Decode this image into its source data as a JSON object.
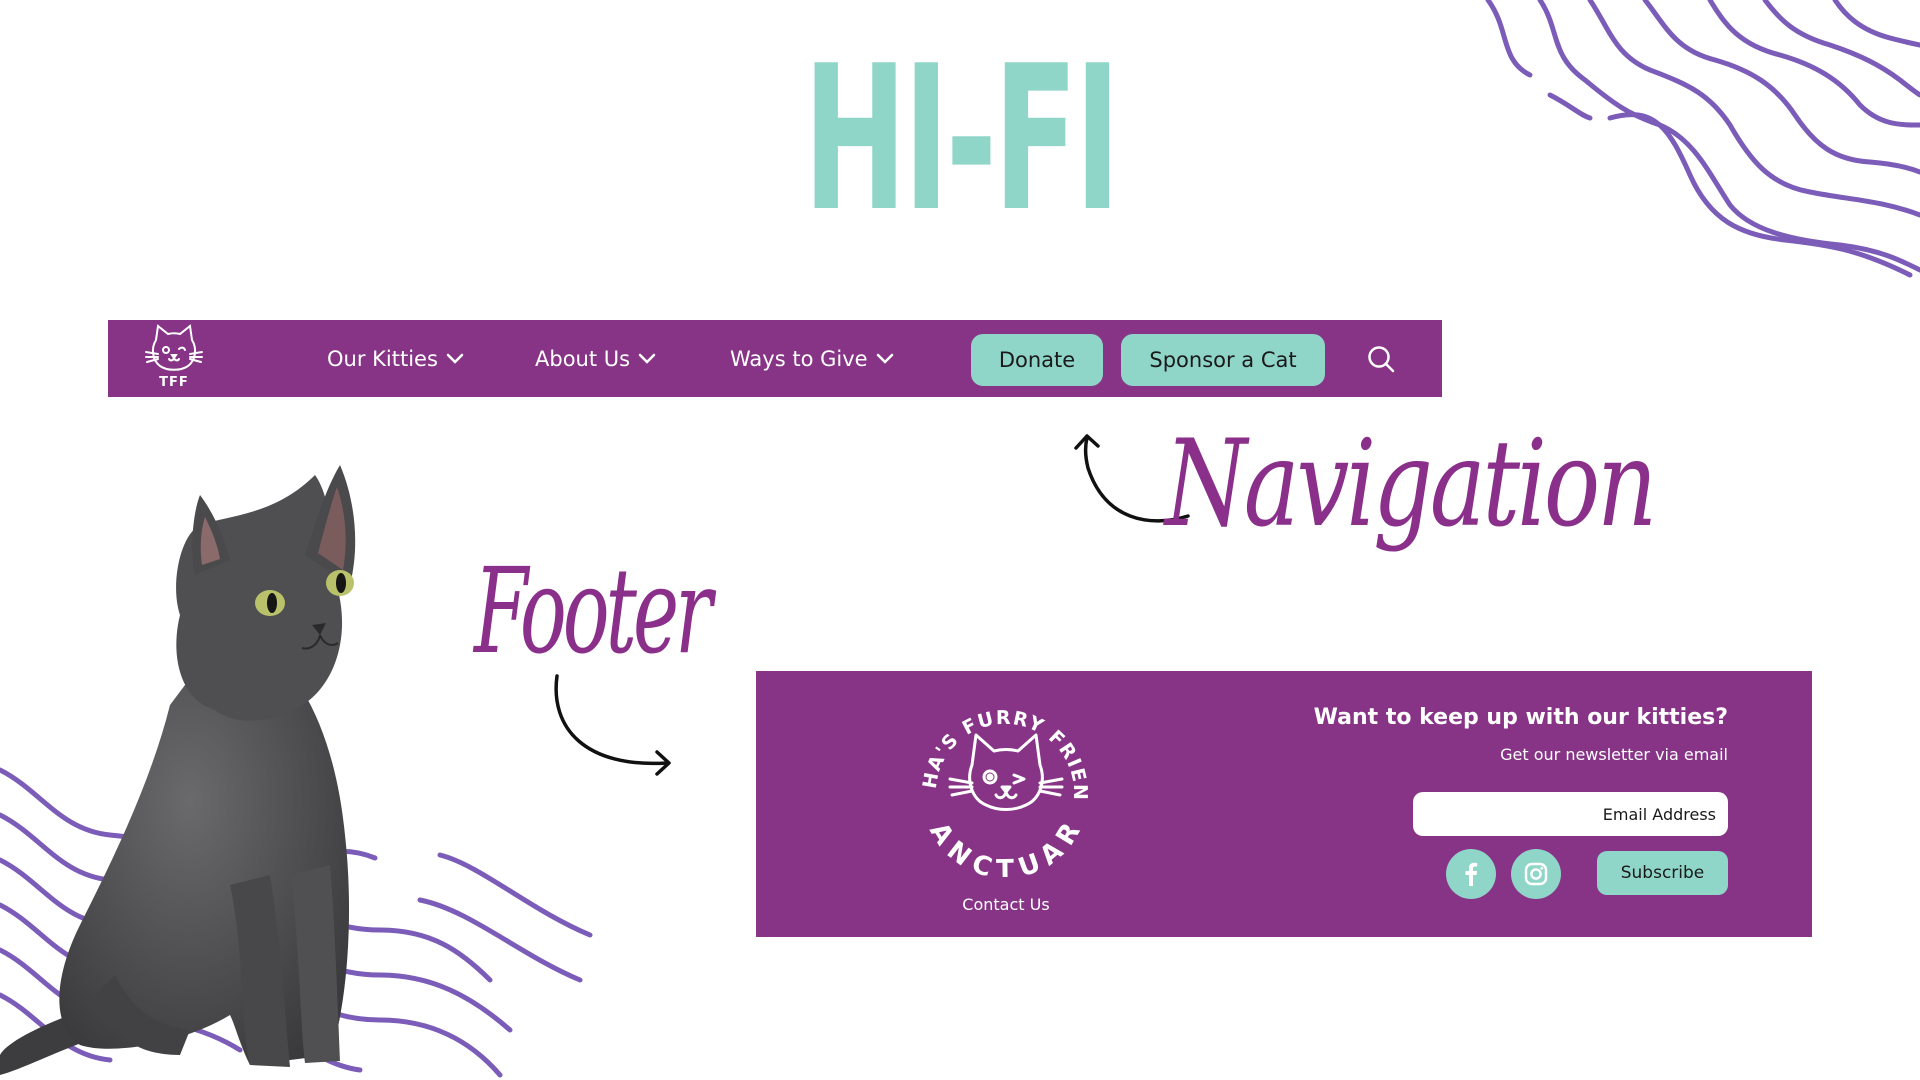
{
  "colors": {
    "brand_purple": "#873487",
    "accent_teal": "#8fd5c8",
    "wave_purple": "#7b5cb8",
    "annotation_purple": "#8a2f8a",
    "arrow_black": "#111111"
  },
  "title": "HI-FI",
  "navigation": {
    "logo_icon": "cat-face-icon",
    "logo_text": "TFF",
    "items": [
      {
        "label": "Our Kitties",
        "icon": "chevron-down-icon"
      },
      {
        "label": "About Us",
        "icon": "chevron-down-icon"
      },
      {
        "label": "Ways to Give",
        "icon": "chevron-down-icon"
      }
    ],
    "donate_label": "Donate",
    "sponsor_label": "Sponsor a Cat",
    "search_icon": "search-icon"
  },
  "annotations": {
    "navigation_label": "Navigation",
    "footer_label": "Footer"
  },
  "footer": {
    "seal": {
      "top_text": "TASHA'S FURRY FRIENDS",
      "bottom_text": "SANCTUARY",
      "icon": "winking-cat-icon"
    },
    "contact_label": "Contact Us",
    "heading": "Want to keep up with our kitties?",
    "subheading": "Get our newsletter via email",
    "email_placeholder": "Email Address",
    "social": [
      {
        "icon": "facebook-icon"
      },
      {
        "icon": "instagram-icon"
      }
    ],
    "subscribe_label": "Subscribe"
  },
  "decor": {
    "photo": "gray-cat-photo",
    "waves": "wavy-line-pattern"
  }
}
